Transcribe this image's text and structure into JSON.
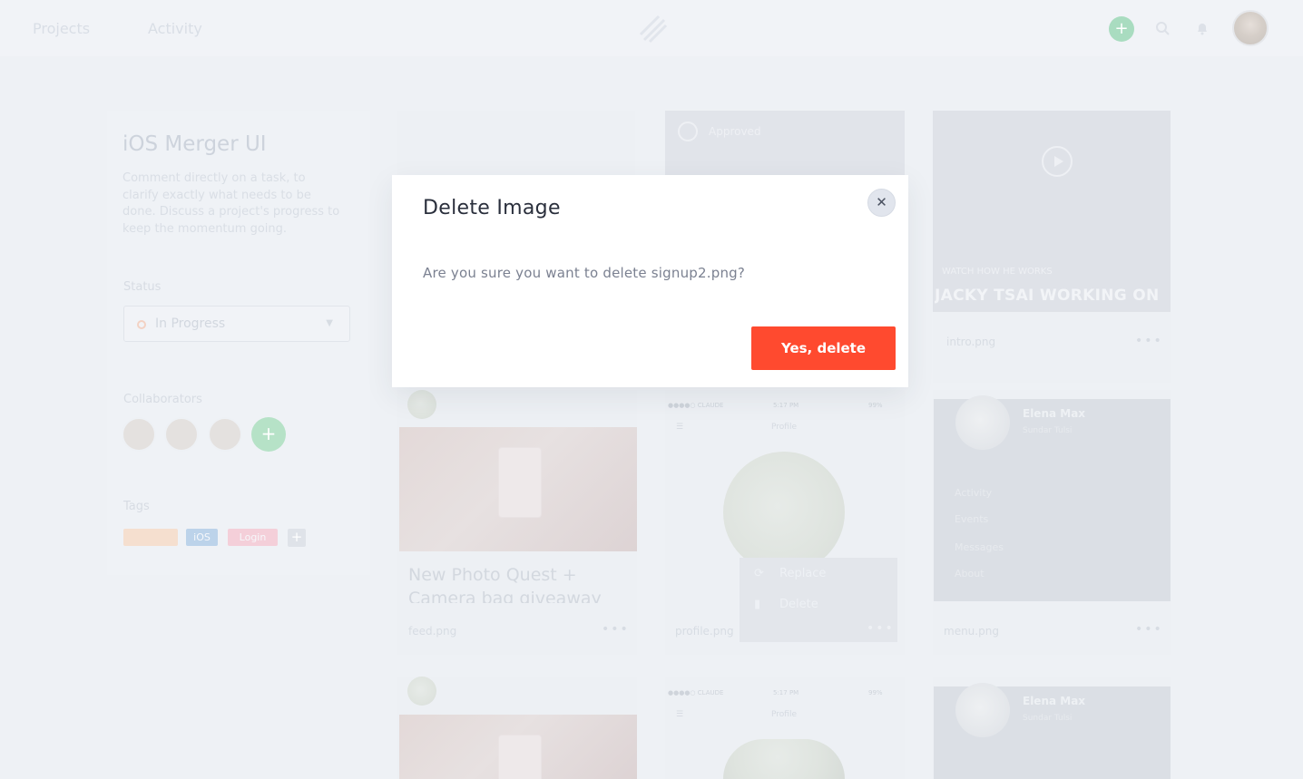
{
  "nav": {
    "projects": "Projects",
    "activity": "Activity",
    "add": "+"
  },
  "project": {
    "title": "iOS Merger UI",
    "description": "Comment directly on a task, to clarify exactly what needs to be done. Discuss a project's progress to keep the momentum going.",
    "status_label": "Status",
    "status_value": "In Progress",
    "collaborators_label": "Collaborators",
    "tags_label": "Tags",
    "tags": [
      {
        "text": "",
        "color": "#f5dfcf"
      },
      {
        "text": "iOS",
        "color": "#bcd3ea"
      },
      {
        "text": "Login",
        "color": "#f4cfd9"
      }
    ]
  },
  "cards": {
    "approved_label": "Approved",
    "video_caption": "WATCH HOW HE WORKS",
    "video_title": "JACKY TSAI WORKING ON",
    "video_file": "intro.png",
    "feed_file": "feed.png",
    "feed_title": "New Photo Quest + Camera bag giveaway",
    "profile_file": "profile.png",
    "menu_file": "menu.png",
    "phone_carrier": "●●●●○ CLAUDE",
    "phone_time": "5:17 PM",
    "phone_battery": "99%",
    "phone_title": "Profile",
    "elena_name": "Elena Max",
    "elena_loc": "Sundar Tulsi",
    "menu_items": [
      "Activity",
      "Events",
      "Messages",
      "About"
    ],
    "dots": "•••"
  },
  "context_menu": {
    "replace": "Replace",
    "delete": "Delete"
  },
  "modal": {
    "title": "Delete Image",
    "close": "✕",
    "body": "Are you sure you want to delete signup2.png?",
    "confirm": "Yes, delete"
  },
  "colors": {
    "accent": "#ff4a2f",
    "modal_title": "#2a2f3c",
    "modal_body": "#7b8191"
  }
}
